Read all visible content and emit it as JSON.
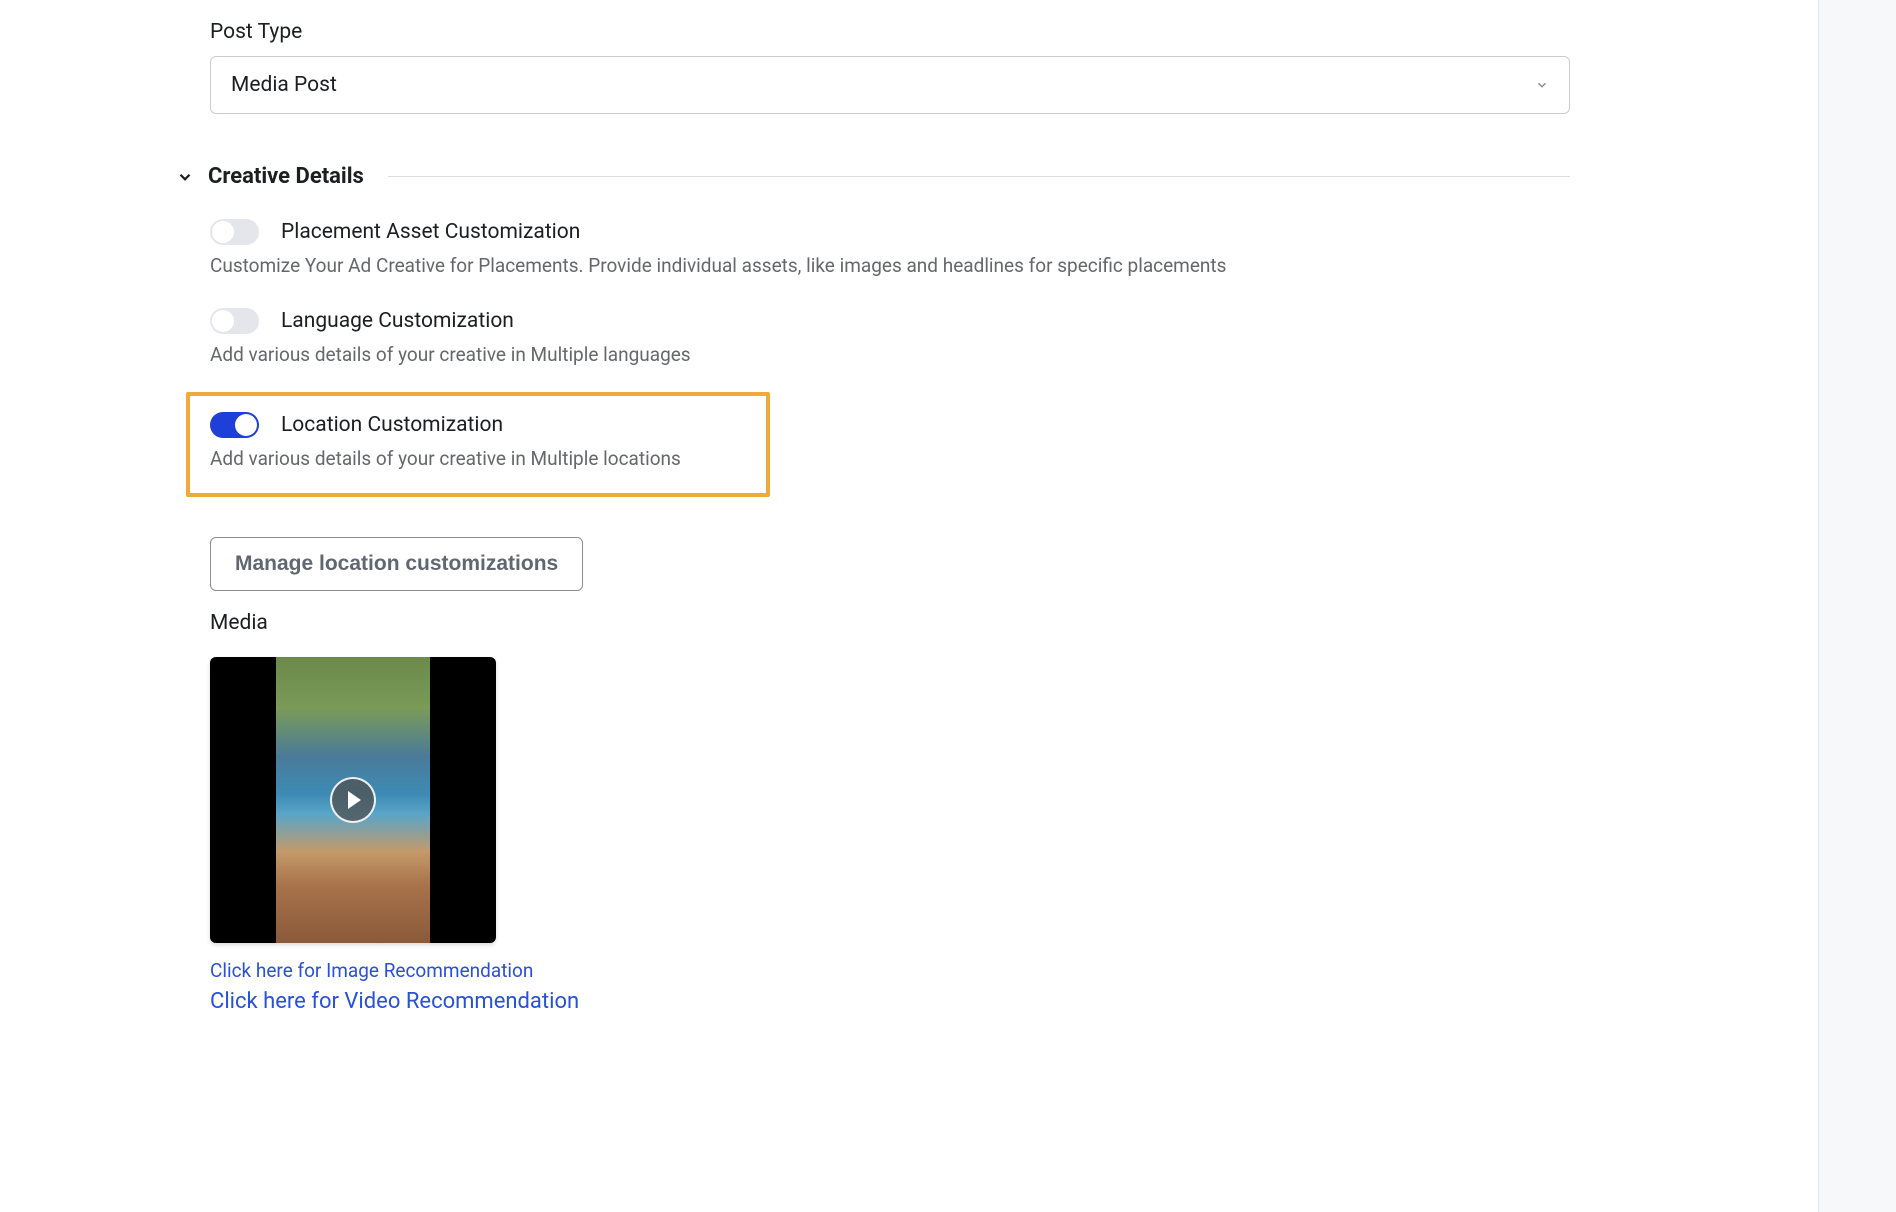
{
  "postType": {
    "label": "Post Type",
    "value": "Media Post"
  },
  "creativeDetails": {
    "title": "Creative Details",
    "toggles": {
      "placement": {
        "label": "Placement Asset Customization",
        "description": "Customize Your Ad Creative for Placements. Provide individual assets, like images and headlines for specific placements",
        "enabled": false
      },
      "language": {
        "label": "Language Customization",
        "description": "Add various details of your creative in Multiple languages",
        "enabled": false
      },
      "location": {
        "label": "Location Customization",
        "description": "Add various details of your creative in Multiple locations",
        "enabled": true
      }
    },
    "manageButton": "Manage location customizations",
    "media": {
      "label": "Media",
      "imageRecLink": "Click here for Image Recommendation",
      "videoRecLink": "Click here for Video Recommendation"
    }
  },
  "colors": {
    "accent": "#1e40d8",
    "highlight": "#f0a93a",
    "link": "#2950d6",
    "textSecondary": "#65676b"
  }
}
